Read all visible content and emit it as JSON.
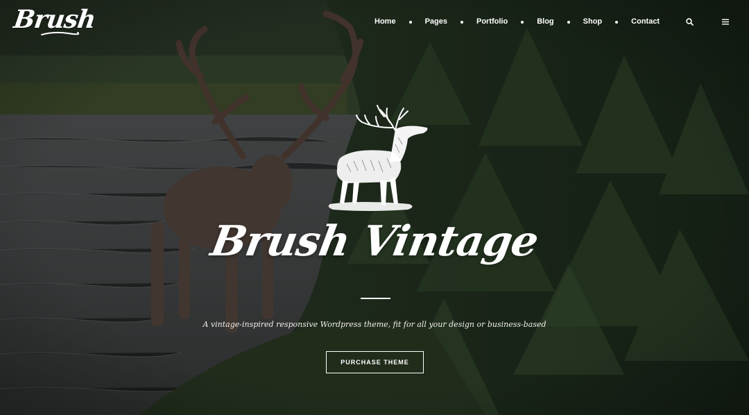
{
  "header": {
    "logo_text": "Brush",
    "nav": {
      "home": "Home",
      "pages": "Pages",
      "portfolio": "Portfolio",
      "blog": "Blog",
      "shop": "Shop",
      "contact": "Contact"
    },
    "icons": {
      "search": "search-icon",
      "menu": "hamburger-menu-icon"
    }
  },
  "hero": {
    "emblem": "stag-emblem-icon",
    "title": "Brush Vintage",
    "tagline": "A vintage-inspired responsive Wordpress theme, fit for all your design or business-based",
    "cta_label": "PURCHASE THEME"
  },
  "colors": {
    "text": "#ffffff",
    "overlay": "#0a0e0c"
  }
}
